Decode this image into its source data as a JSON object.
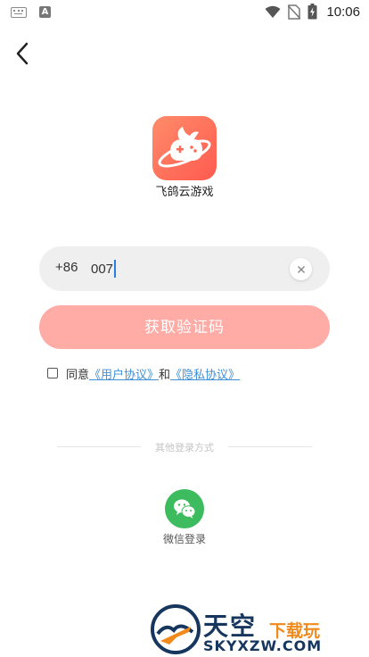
{
  "status_bar": {
    "time": "10:06",
    "icons": [
      "keyboard-icon",
      "a-icon",
      "wifi-icon",
      "no-sim-icon",
      "battery-charging-icon"
    ],
    "a_label": "A"
  },
  "nav": {
    "back_icon": "chevron-left-icon"
  },
  "app": {
    "name": "飞鸽云游戏",
    "logo_icon": "pigeon-gamepad-logo"
  },
  "phone": {
    "country_code": "+86",
    "value": "007"
  },
  "buttons": {
    "get_code": "获取验证码",
    "get_code_color": "#ffaba6"
  },
  "agreement": {
    "prefix": "同意",
    "user_agreement": "《用户协议》",
    "joiner": "和",
    "privacy_agreement": "《隐私协议》",
    "link_color": "#3f8fd6"
  },
  "other_login": {
    "divider_text": "其他登录方式",
    "wechat_label": "微信登录",
    "wechat_color": "#3dbb5f"
  },
  "watermark": {
    "main": "天空",
    "sub": "下载玩",
    "url": "SKYXZW.COM"
  }
}
